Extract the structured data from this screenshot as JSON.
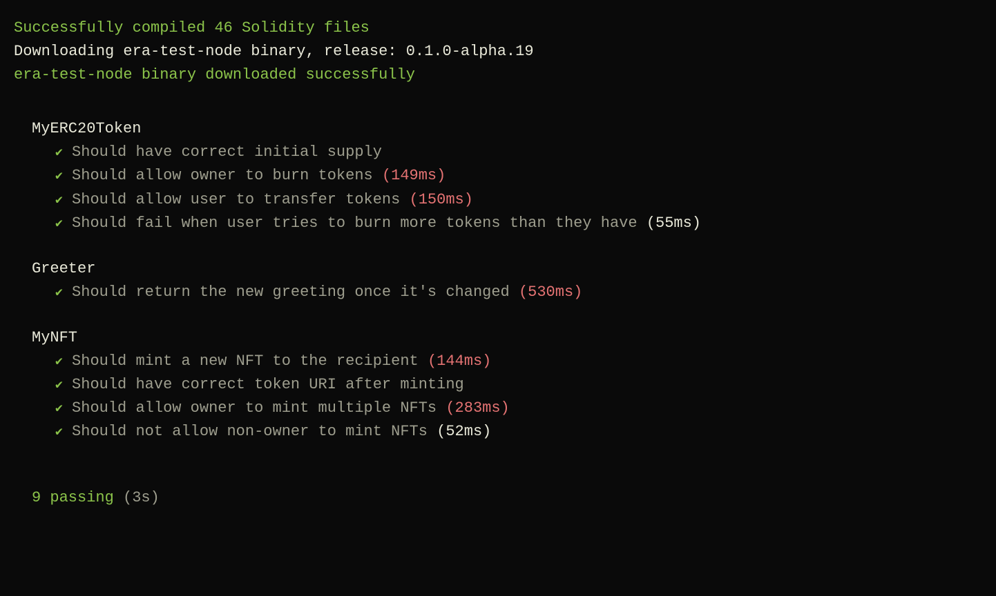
{
  "header": {
    "compiled": "Successfully compiled 46 Solidity files",
    "downloading": "Downloading era-test-node binary, release: 0.1.0-alpha.19",
    "downloaded": "era-test-node binary downloaded successfully"
  },
  "check": "✔",
  "suites": [
    {
      "name": "MyERC20Token",
      "tests": [
        {
          "desc": "Should have correct initial supply",
          "time": "",
          "timeColor": ""
        },
        {
          "desc": "Should allow owner to burn tokens",
          "time": "(149ms)",
          "timeColor": "red"
        },
        {
          "desc": "Should allow user to transfer tokens",
          "time": "(150ms)",
          "timeColor": "red"
        },
        {
          "desc": "Should fail when user tries to burn more tokens than they have",
          "time": "(55ms)",
          "timeColor": "white"
        }
      ]
    },
    {
      "name": "Greeter",
      "tests": [
        {
          "desc": "Should return the new greeting once it's changed",
          "time": "(530ms)",
          "timeColor": "red"
        }
      ]
    },
    {
      "name": "MyNFT",
      "tests": [
        {
          "desc": "Should mint a new NFT to the recipient",
          "time": "(144ms)",
          "timeColor": "red"
        },
        {
          "desc": "Should have correct token URI after minting",
          "time": "",
          "timeColor": ""
        },
        {
          "desc": "Should allow owner to mint multiple NFTs",
          "time": "(283ms)",
          "timeColor": "red"
        },
        {
          "desc": "Should not allow non-owner to mint NFTs",
          "time": "(52ms)",
          "timeColor": "white"
        }
      ]
    }
  ],
  "summary": {
    "passing": "9 passing",
    "duration": "(3s)"
  }
}
